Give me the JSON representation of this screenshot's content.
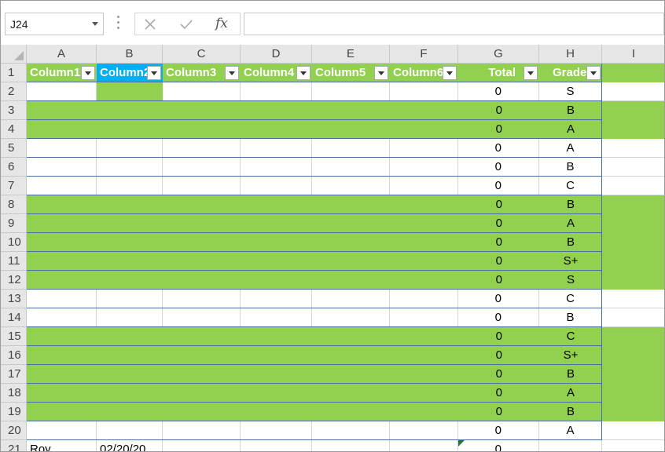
{
  "name_box": "J24",
  "formula_bar": {
    "cancel_icon": "close-icon",
    "enter_icon": "check-icon",
    "fx_label": "fx",
    "formula_value": ""
  },
  "columns": [
    "A",
    "B",
    "C",
    "D",
    "E",
    "F",
    "G",
    "H",
    "I"
  ],
  "table_headers": [
    "Column1",
    "Column2",
    "Column3",
    "Column4",
    "Column5",
    "Column6",
    "Total",
    "Grade"
  ],
  "rows": [
    {
      "num": "1"
    },
    {
      "num": "2",
      "total": "0",
      "grade": "S"
    },
    {
      "num": "3",
      "total": "0",
      "grade": "B"
    },
    {
      "num": "4",
      "total": "0",
      "grade": "A"
    },
    {
      "num": "5",
      "total": "0",
      "grade": "A"
    },
    {
      "num": "6",
      "total": "0",
      "grade": "B"
    },
    {
      "num": "7",
      "total": "0",
      "grade": "C"
    },
    {
      "num": "8",
      "total": "0",
      "grade": "B"
    },
    {
      "num": "9",
      "total": "0",
      "grade": "A"
    },
    {
      "num": "10",
      "total": "0",
      "grade": "B"
    },
    {
      "num": "11",
      "total": "0",
      "grade": "S+"
    },
    {
      "num": "12",
      "total": "0",
      "grade": "S"
    },
    {
      "num": "13",
      "total": "0",
      "grade": "C"
    },
    {
      "num": "14",
      "total": "0",
      "grade": "B"
    },
    {
      "num": "15",
      "total": "0",
      "grade": "C"
    },
    {
      "num": "16",
      "total": "0",
      "grade": "S+"
    },
    {
      "num": "17",
      "total": "0",
      "grade": "B"
    },
    {
      "num": "18",
      "total": "0",
      "grade": "A"
    },
    {
      "num": "19",
      "total": "0",
      "grade": "B"
    },
    {
      "num": "20",
      "total": "0",
      "grade": "A"
    },
    {
      "num": "21",
      "col_a": "Roy",
      "col_b": "02/20/20",
      "total": "0",
      "grade": ""
    }
  ],
  "colors": {
    "highlight_green": "#92d050",
    "selected_header": "#00b0f0",
    "header_gray": "#e6e6e6",
    "table_border": "#4a6fa5"
  }
}
